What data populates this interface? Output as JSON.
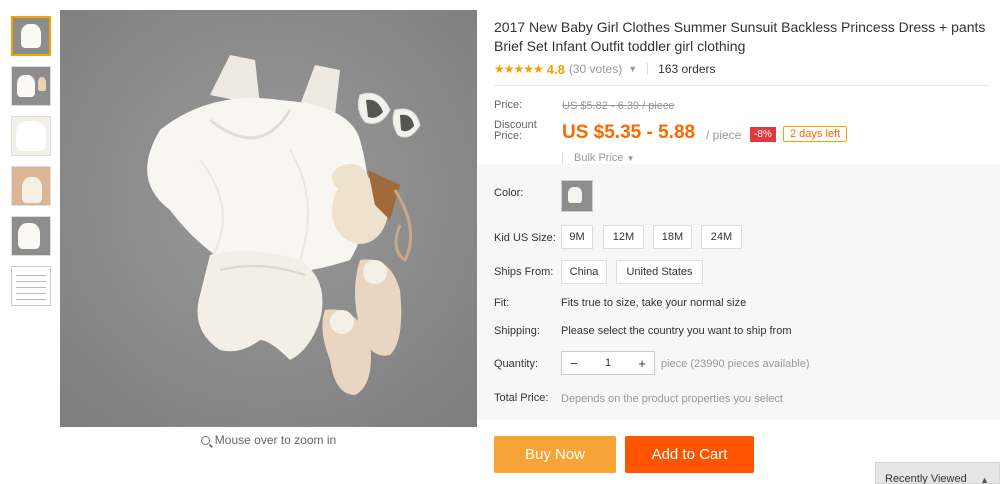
{
  "product": {
    "title": "2017 New Baby Girl Clothes Summer Sunsuit Backless Princess Dress + pants Brief Set Infant Outfit toddler girl clothing",
    "stars": "★★★★★",
    "rating": "4.8",
    "votes": "(30 votes)",
    "orders": "163 orders"
  },
  "price": {
    "price_label": "Price:",
    "original": "US $5.82 - 6.39 / piece",
    "discount_label_1": "Discount",
    "discount_label_2": "Price:",
    "discount": "US $5.35 - 5.88",
    "per_piece": "/ piece",
    "pct": "-8%",
    "days_left": "2 days left",
    "bulk": "Bulk Price"
  },
  "props": {
    "color_label": "Color:",
    "size_label": "Kid US Size:",
    "sizes": [
      "9M",
      "12M",
      "18M",
      "24M"
    ],
    "ships_label": "Ships From:",
    "ships": [
      "China",
      "United States"
    ],
    "fit_label": "Fit:",
    "fit_value": "Fits true to size, take your normal size",
    "shipping_label": "Shipping:",
    "shipping_value": "Please select the country you want to ship from",
    "qty_label": "Quantity:",
    "qty_minus": "−",
    "qty_value": "1",
    "qty_plus": "+",
    "qty_available": "piece (23990 pieces available)",
    "total_label": "Total Price:",
    "total_value": "Depends on the product properties you select"
  },
  "gallery": {
    "zoom_hint": "Mouse over to zoom in"
  },
  "actions": {
    "buy_now": "Buy Now",
    "add_to_cart": "Add to Cart"
  },
  "recently_viewed": "Recently Viewed",
  "colors": {
    "accent_orange": "#ff5500",
    "buy_now": "#f7a335",
    "price_orange": "#ff6600",
    "star": "#f7a100",
    "badge_red": "#e4393c"
  }
}
